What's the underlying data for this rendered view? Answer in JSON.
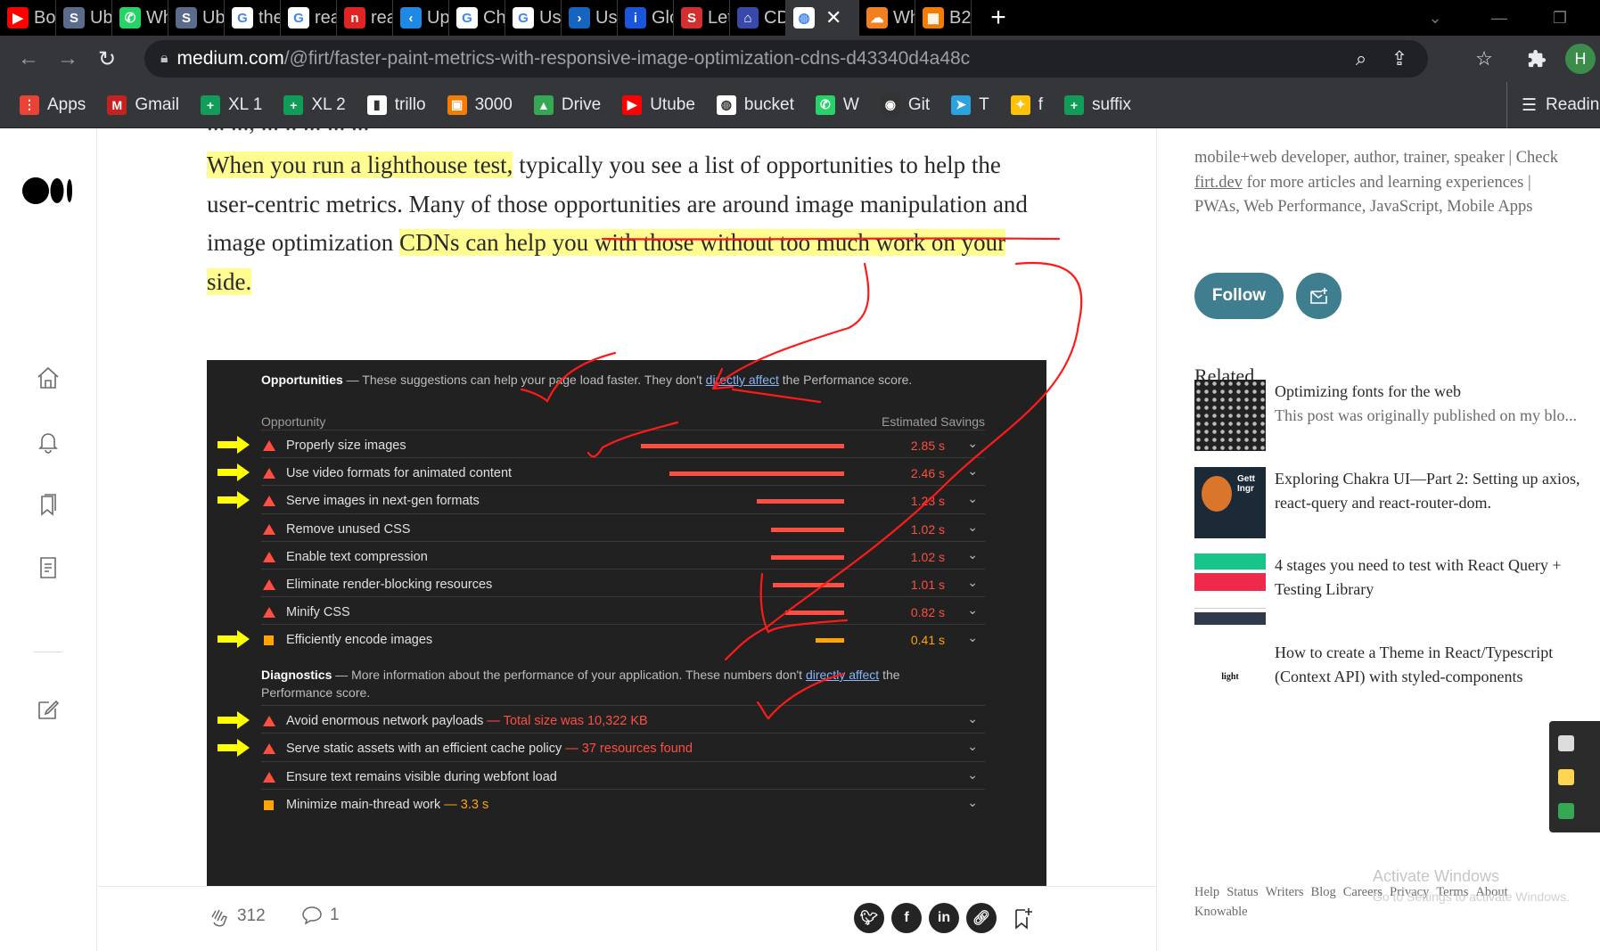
{
  "tabs": [
    {
      "label": "Boy",
      "color": "#ff0000",
      "glyph": "▶"
    },
    {
      "label": "Ub",
      "color": "#5a6b8c",
      "glyph": "S"
    },
    {
      "label": "Wh",
      "color": "#25d366",
      "glyph": "✆"
    },
    {
      "label": "Ub",
      "color": "#5a6b8c",
      "glyph": "S"
    },
    {
      "label": "the",
      "color": "#ffffff",
      "glyph": "G"
    },
    {
      "label": "rea",
      "color": "#ffffff",
      "glyph": "G"
    },
    {
      "label": "rea",
      "color": "#e02424",
      "glyph": "n"
    },
    {
      "label": "Up",
      "color": "#1e88e5",
      "glyph": "‹"
    },
    {
      "label": "Ch",
      "color": "#ffffff",
      "glyph": "G"
    },
    {
      "label": "Us",
      "color": "#ffffff",
      "glyph": "G"
    },
    {
      "label": "Us",
      "color": "#1565c0",
      "glyph": "›"
    },
    {
      "label": "Glo",
      "color": "#1a56db",
      "glyph": "i"
    },
    {
      "label": "Let",
      "color": "#d32f2f",
      "glyph": "S"
    },
    {
      "label": "CD",
      "color": "#3949ab",
      "glyph": "⌂"
    },
    {
      "label": "",
      "color": "#ffffff",
      "glyph": "◍",
      "active": true
    },
    {
      "label": "Wh",
      "color": "#f38020",
      "glyph": "☁"
    },
    {
      "label": "B2",
      "color": "#f57c00",
      "glyph": "▦"
    }
  ],
  "address": {
    "host": "medium.com",
    "path": "/@firt/faster-paint-metrics-with-responsive-image-optimization-cdns-d43340d4a48c"
  },
  "bookmarks": [
    {
      "label": "Apps",
      "color": "#ea4335",
      "glyph": "⋮"
    },
    {
      "label": "Gmail",
      "color": "#c5221f",
      "glyph": "M"
    },
    {
      "label": "XL 1",
      "color": "#0f9d58",
      "glyph": "+"
    },
    {
      "label": "XL 2",
      "color": "#0f9d58",
      "glyph": "+"
    },
    {
      "label": "trillo",
      "color": "#ffffff",
      "glyph": "▮"
    },
    {
      "label": "3000",
      "color": "#f57c00",
      "glyph": "▣"
    },
    {
      "label": "Drive",
      "color": "#34a853",
      "glyph": "▲"
    },
    {
      "label": "Utube",
      "color": "#ff0000",
      "glyph": "▶"
    },
    {
      "label": "bucket",
      "color": "#ffffff",
      "glyph": "◍"
    },
    {
      "label": "W",
      "color": "#25d366",
      "glyph": "✆"
    },
    {
      "label": "Git",
      "color": "#333333",
      "glyph": "◉"
    },
    {
      "label": "T",
      "color": "#2aa3e0",
      "glyph": "➤"
    },
    {
      "label": "f",
      "color": "#ffc107",
      "glyph": "✦"
    },
    {
      "label": "suffix",
      "color": "#0f9d58",
      "glyph": "+"
    }
  ],
  "bookmarks_right": "Readin",
  "article": {
    "prev_line": "... ..., ... .. ... ... ...",
    "para_hl1": "When you run a lighthouse test,",
    "para_mid": " typically you see a list of opportunities to help the user-centric metrics. Many of those opportunities are around image manipulation and image optimization ",
    "para_hl2": "CDNs can help you with those without too much work on your side."
  },
  "lighthouse": {
    "opp_title": "Opportunities",
    "opp_desc_pre": "— These suggestions can help your page load faster. They don't ",
    "opp_link": "directly affect",
    "opp_desc_post": " the Performance score.",
    "col_opportunity": "Opportunity",
    "col_savings": "Estimated Savings",
    "opportunities": [
      {
        "label": "Properly size images",
        "value": "2.85 s",
        "fraction": 1.0,
        "severity": "fail",
        "arrow": true
      },
      {
        "label": "Use video formats for animated content",
        "value": "2.46 s",
        "fraction": 0.86,
        "severity": "fail",
        "arrow": true
      },
      {
        "label": "Serve images in next-gen formats",
        "value": "1.23 s",
        "fraction": 0.43,
        "severity": "fail",
        "arrow": true
      },
      {
        "label": "Remove unused CSS",
        "value": "1.02 s",
        "fraction": 0.36,
        "severity": "fail",
        "arrow": false
      },
      {
        "label": "Enable text compression",
        "value": "1.02 s",
        "fraction": 0.36,
        "severity": "fail",
        "arrow": false
      },
      {
        "label": "Eliminate render-blocking resources",
        "value": "1.01 s",
        "fraction": 0.35,
        "severity": "fail",
        "arrow": false
      },
      {
        "label": "Minify CSS",
        "value": "0.82 s",
        "fraction": 0.29,
        "severity": "fail",
        "arrow": false
      },
      {
        "label": "Efficiently encode images",
        "value": "0.41 s",
        "fraction": 0.14,
        "severity": "average",
        "arrow": true
      }
    ],
    "diag_title": "Diagnostics",
    "diag_desc_pre": "— More information about the performance of your application. These numbers don't ",
    "diag_link": "directly affect",
    "diag_desc_post": " the",
    "diag_desc_line2": "Performance score.",
    "diagnostics": [
      {
        "label": "Avoid enormous network payloads",
        "extra": "— Total size was 10,322 KB",
        "severity": "fail",
        "arrow": true
      },
      {
        "label": "Serve static assets with an efficient cache policy",
        "extra": "— 37 resources found",
        "severity": "fail",
        "arrow": true
      },
      {
        "label": "Ensure text remains visible during webfont load",
        "extra": "",
        "severity": "fail",
        "arrow": false
      },
      {
        "label": "Minimize main-thread work",
        "extra": "— 3.3 s",
        "severity": "average",
        "arrow": false
      }
    ]
  },
  "actions": {
    "claps": "312",
    "comments": "1"
  },
  "sidebar": {
    "bio_pre": "mobile+web developer, author, trainer, speaker | Check ",
    "bio_link": "firt.dev",
    "bio_post": " for more articles and learning experiences | PWAs, Web Performance, JavaScript, Mobile Apps",
    "follow": "Follow",
    "related_heading": "Related",
    "related": [
      {
        "title": "Optimizing fonts for the web",
        "sub": "This post was originally published on my blo..."
      },
      {
        "title": "Exploring Chakra UI—Part 2: Setting up axios, react-query and react-router-dom.",
        "sub": ""
      },
      {
        "title": "4 stages you need to test with React Query + Testing Library",
        "sub": ""
      },
      {
        "title": "How to create a Theme in React/Typescript (Context API) with styled-components",
        "sub": ""
      }
    ],
    "footer_links": [
      "Help",
      "Status",
      "Writers",
      "Blog",
      "Careers",
      "Privacy",
      "Terms",
      "About",
      "Knowable"
    ]
  },
  "windows": {
    "activate": "Activate Windows",
    "activate_sub": "Go to Settings to activate Windows."
  },
  "colors": {
    "highlight": "#fffd8f",
    "follow": "#3e7e8f",
    "annotation": "#ff0000",
    "arrow": "#ffff00",
    "fail": "#ff4e42",
    "average": "#ffa400"
  }
}
